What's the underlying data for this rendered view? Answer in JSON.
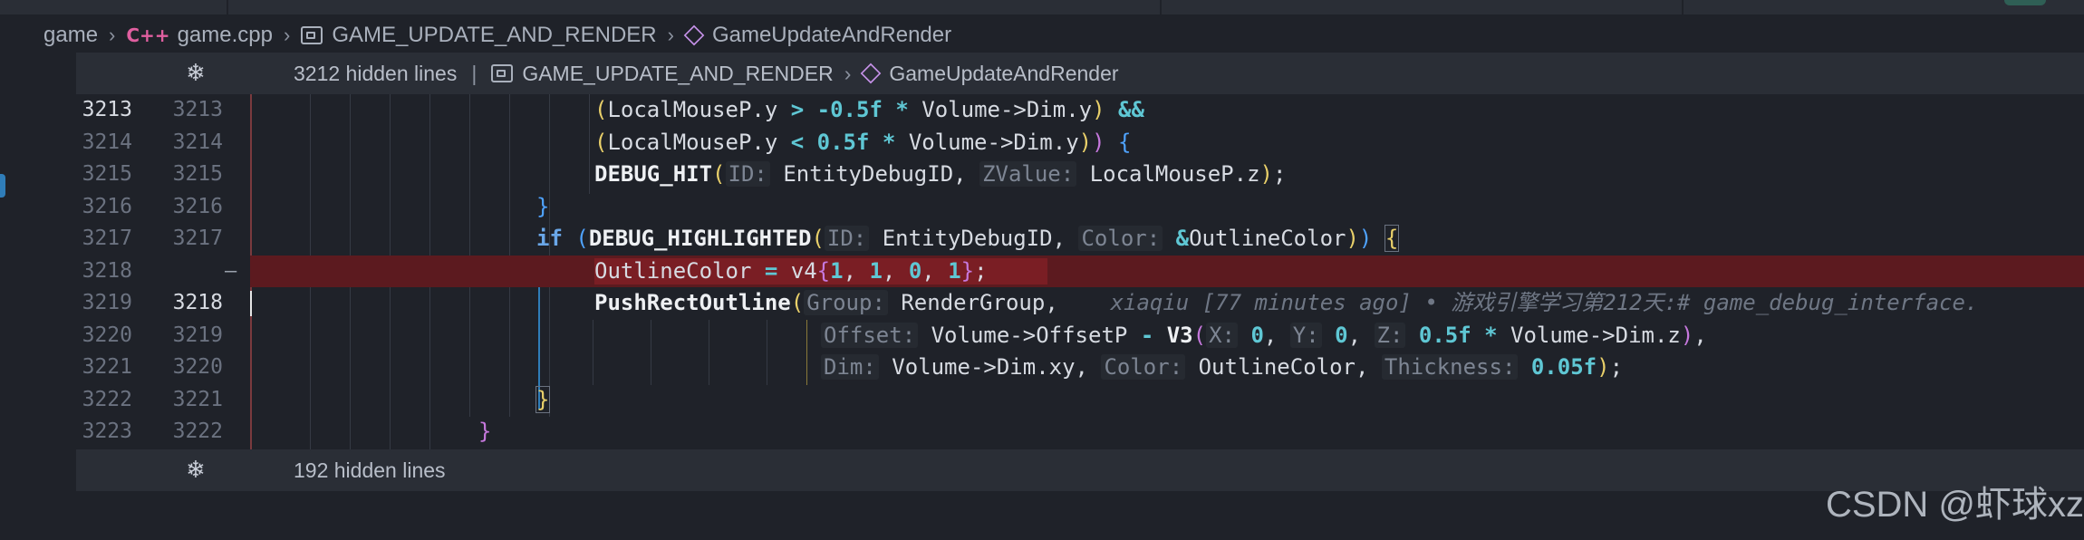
{
  "colors": {
    "background": "#1f2229",
    "removed_line": "#5c1a1f",
    "keyword": "#6aa7e8",
    "number": "#5fc7d4",
    "active_guide": "#2f7db8"
  },
  "breadcrumb": {
    "items": [
      "game",
      "game.cpp",
      "GAME_UPDATE_AND_RENDER",
      "GameUpdateAndRender"
    ],
    "icons": [
      "cpp-icon",
      "symbol-macro-icon",
      "method-icon"
    ]
  },
  "fold_top": {
    "label": "3212 hidden lines",
    "separator": "|",
    "path": [
      "GAME_UPDATE_AND_RENDER",
      "GameUpdateAndRender"
    ]
  },
  "fold_bottom": {
    "label": "192 hidden lines"
  },
  "lines": [
    {
      "orig": "3213",
      "mod": "3213"
    },
    {
      "orig": "3214",
      "mod": "3214"
    },
    {
      "orig": "3215",
      "mod": "3215"
    },
    {
      "orig": "3216",
      "mod": "3216"
    },
    {
      "orig": "3217",
      "mod": "3217"
    },
    {
      "orig": "3218",
      "mod": "",
      "marker": "—"
    },
    {
      "orig": "3219",
      "mod": "3218"
    },
    {
      "orig": "3220",
      "mod": "3219"
    },
    {
      "orig": "3221",
      "mod": "3220"
    },
    {
      "orig": "3222",
      "mod": "3221"
    },
    {
      "orig": "3223",
      "mod": "3222"
    }
  ],
  "blame": "xiaqiu [77 minutes ago] • 游戏引擎学习第212天:# game_debug_interface.",
  "watermark": "CSDN @虾球xz"
}
